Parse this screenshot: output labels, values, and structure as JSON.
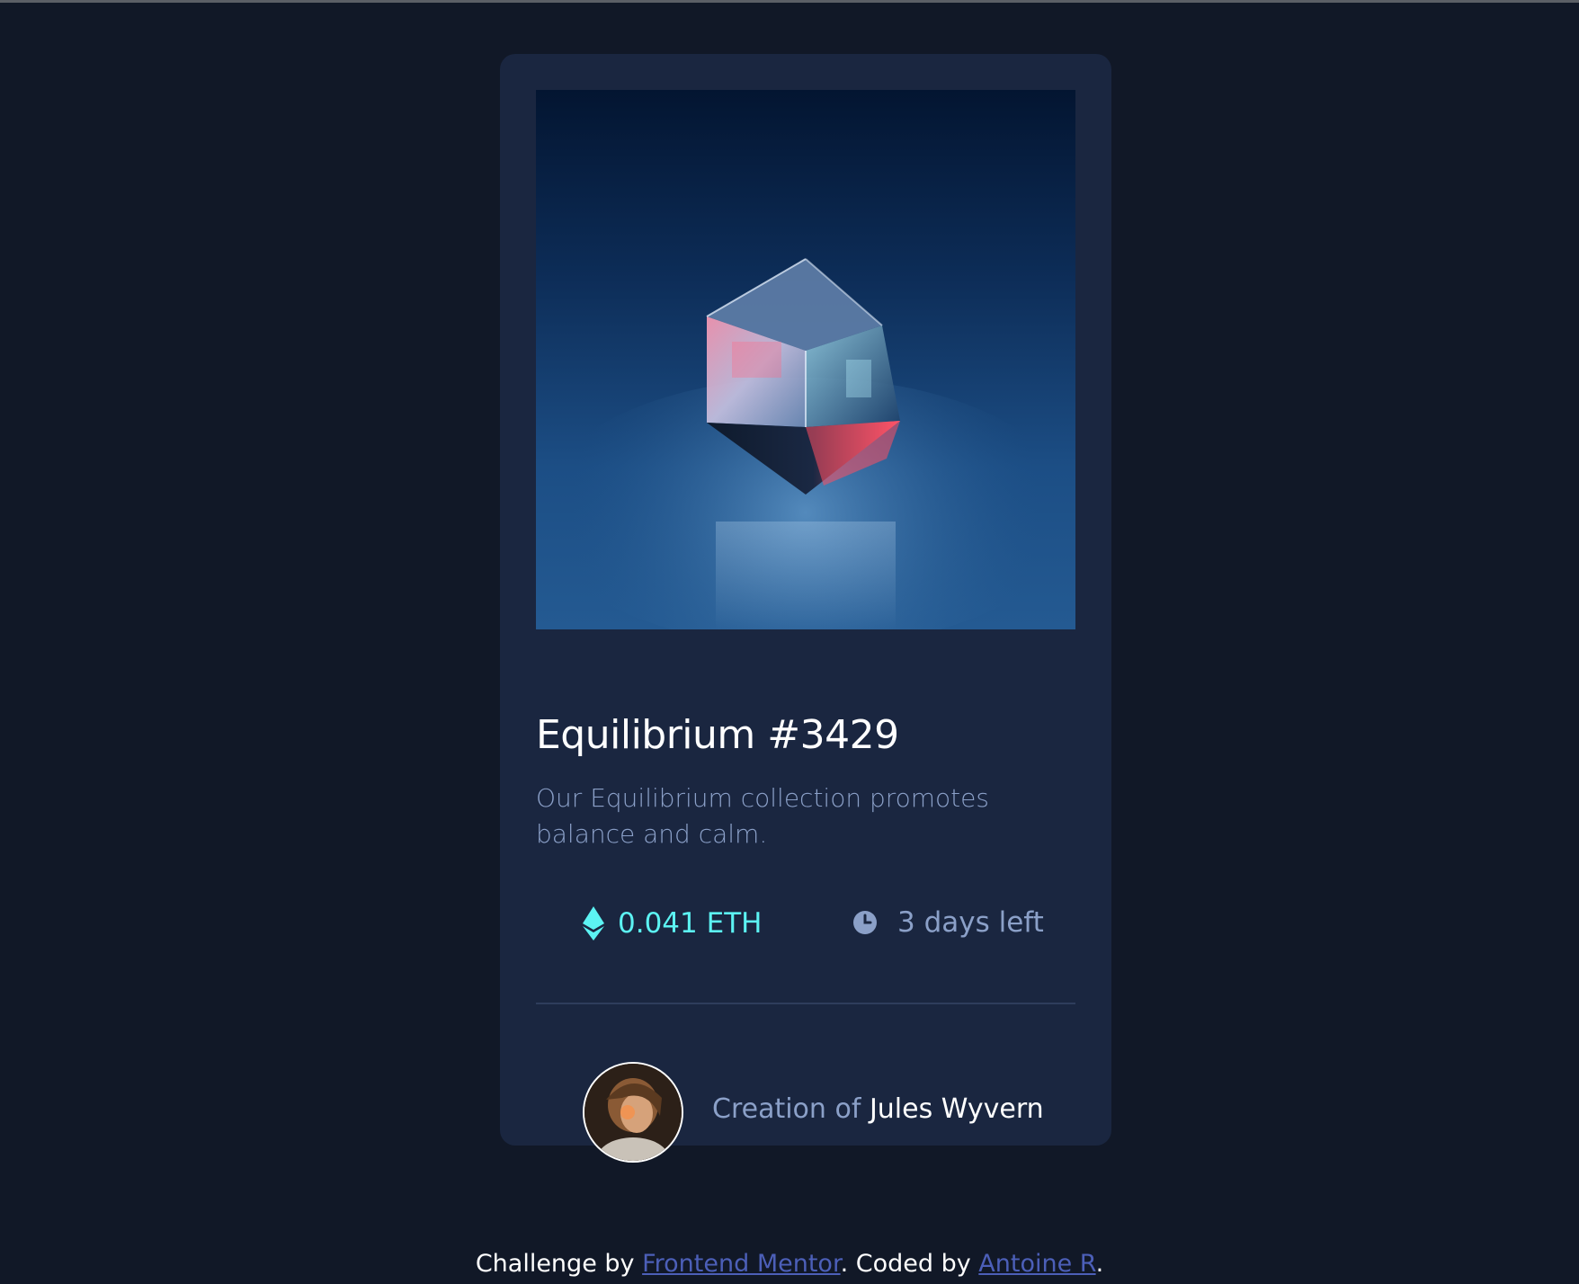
{
  "card": {
    "image_alt": "Equilibrium cube",
    "title": "Equilibrium #3429",
    "description": "Our Equilibrium collection promotes balance and calm.",
    "price": "0.041 ETH",
    "time_left": "3 days left",
    "creator_prefix": "Creation of",
    "creator_name": "Jules Wyvern"
  },
  "footer": {
    "challenge_prefix": "Challenge by",
    "challenge_link": "Frontend Mentor",
    "coded_prefix": ". Coded by",
    "coded_link": "Antoine R",
    "suffix": "."
  },
  "icons": {
    "price": "ethereum-icon",
    "time": "clock-icon"
  },
  "colors": {
    "page_background": "#111827",
    "card_background": "#1a2640",
    "accent_cyan": "#5cf3f3",
    "muted_text": "#8ba0c8",
    "link": "#4c5fb8"
  }
}
